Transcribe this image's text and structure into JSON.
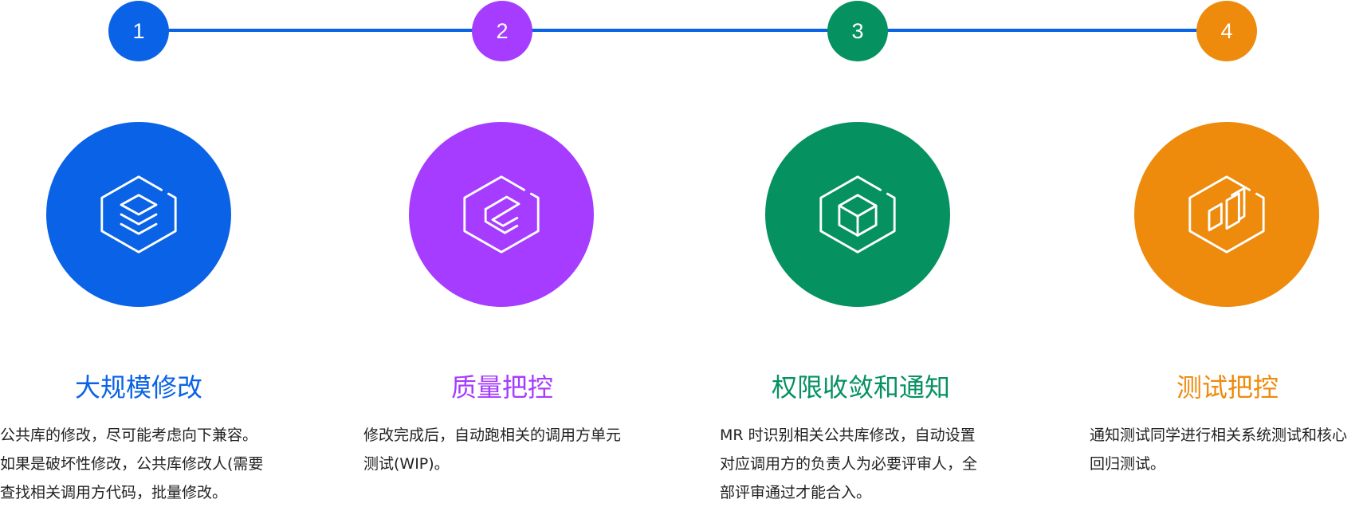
{
  "colors": {
    "blue": "#0a63e6",
    "purple": "#a63cff",
    "green": "#069161",
    "orange": "#ee8a0c"
  },
  "steps": [
    {
      "number": "1",
      "title": "大规模修改",
      "icon": "stacked-layers-icon",
      "color": "#0a63e6",
      "description": [
        "公共库的修改，尽可能考虑向下兼容。",
        "如果是破坏性修改，公共库修改人(需要",
        "查找相关调用方代码，批量修改。"
      ]
    },
    {
      "number": "2",
      "title": "质量把控",
      "icon": "quality-link-icon",
      "color": "#a63cff",
      "description": [
        "修改完成后，自动跑相关的调用方单元",
        "测试(WIP)。"
      ]
    },
    {
      "number": "3",
      "title": "权限收敛和通知",
      "icon": "cube-icon",
      "color": "#069161",
      "description": [
        "MR 时识别相关公共库修改，自动设置",
        "对应调用方的负责人为必要评审人，全",
        "部评审通过才能合入。"
      ]
    },
    {
      "number": "4",
      "title": "测试把控",
      "icon": "test-blocks-icon",
      "color": "#ee8a0c",
      "description": [
        "通知测试同学进行相关系统测试和核心",
        "回归测试。"
      ]
    }
  ]
}
